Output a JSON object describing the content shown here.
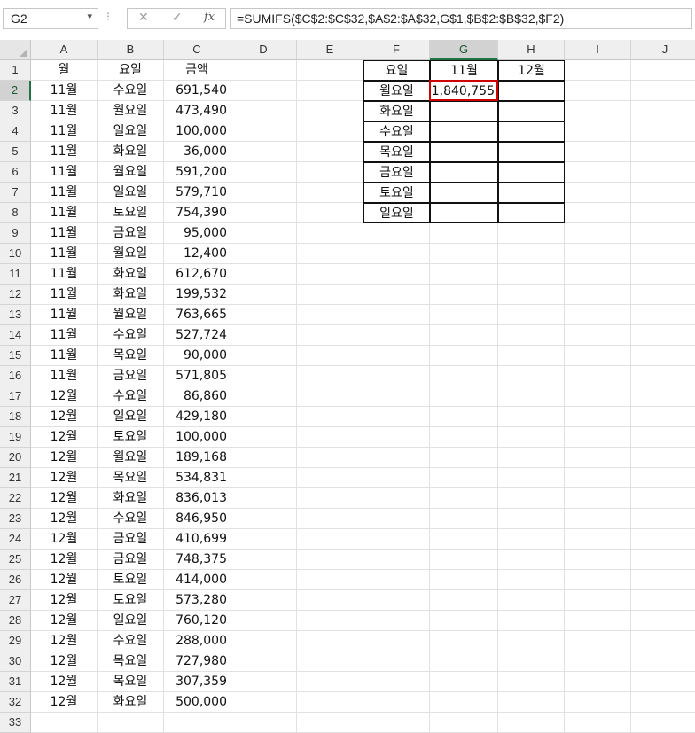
{
  "formula_bar": {
    "name_box": "G2",
    "cancel_icon": "✕",
    "enter_icon": "✓",
    "fx_label": "fx",
    "formula": "=SUMIFS($C$2:$C$32,$A$2:$A$32,G$1,$B$2:$B$32,$F2)"
  },
  "sheet": {
    "columns": [
      "A",
      "B",
      "C",
      "D",
      "E",
      "F",
      "G",
      "H",
      "I",
      "J"
    ],
    "selected_column": "G",
    "selected_row": 2,
    "header_row": {
      "month": "월",
      "day": "요일",
      "amount": "금액"
    },
    "rows": [
      {
        "month": "11월",
        "day": "수요일",
        "amount": "691,540"
      },
      {
        "month": "11월",
        "day": "월요일",
        "amount": "473,490"
      },
      {
        "month": "11월",
        "day": "일요일",
        "amount": "100,000"
      },
      {
        "month": "11월",
        "day": "화요일",
        "amount": "36,000"
      },
      {
        "month": "11월",
        "day": "월요일",
        "amount": "591,200"
      },
      {
        "month": "11월",
        "day": "일요일",
        "amount": "579,710"
      },
      {
        "month": "11월",
        "day": "토요일",
        "amount": "754,390"
      },
      {
        "month": "11월",
        "day": "금요일",
        "amount": "95,000"
      },
      {
        "month": "11월",
        "day": "월요일",
        "amount": "12,400"
      },
      {
        "month": "11월",
        "day": "화요일",
        "amount": "612,670"
      },
      {
        "month": "11월",
        "day": "화요일",
        "amount": "199,532"
      },
      {
        "month": "11월",
        "day": "월요일",
        "amount": "763,665"
      },
      {
        "month": "11월",
        "day": "수요일",
        "amount": "527,724"
      },
      {
        "month": "11월",
        "day": "목요일",
        "amount": "90,000"
      },
      {
        "month": "11월",
        "day": "금요일",
        "amount": "571,805"
      },
      {
        "month": "12월",
        "day": "수요일",
        "amount": "86,860"
      },
      {
        "month": "12월",
        "day": "일요일",
        "amount": "429,180"
      },
      {
        "month": "12월",
        "day": "토요일",
        "amount": "100,000"
      },
      {
        "month": "12월",
        "day": "월요일",
        "amount": "189,168"
      },
      {
        "month": "12월",
        "day": "목요일",
        "amount": "534,831"
      },
      {
        "month": "12월",
        "day": "화요일",
        "amount": "836,013"
      },
      {
        "month": "12월",
        "day": "수요일",
        "amount": "846,950"
      },
      {
        "month": "12월",
        "day": "금요일",
        "amount": "410,699"
      },
      {
        "month": "12월",
        "day": "금요일",
        "amount": "748,375"
      },
      {
        "month": "12월",
        "day": "토요일",
        "amount": "414,000"
      },
      {
        "month": "12월",
        "day": "토요일",
        "amount": "573,280"
      },
      {
        "month": "12월",
        "day": "일요일",
        "amount": "760,120"
      },
      {
        "month": "12월",
        "day": "수요일",
        "amount": "288,000"
      },
      {
        "month": "12월",
        "day": "목요일",
        "amount": "727,980"
      },
      {
        "month": "12월",
        "day": "목요일",
        "amount": "307,359"
      },
      {
        "month": "12월",
        "day": "화요일",
        "amount": "500,000"
      }
    ],
    "summary": {
      "header": [
        "요일",
        "11월",
        "12월"
      ],
      "days": [
        "월요일",
        "화요일",
        "수요일",
        "목요일",
        "금요일",
        "토요일",
        "일요일"
      ],
      "values": [
        [
          "1,840,755",
          ""
        ],
        [
          "",
          ""
        ],
        [
          "",
          ""
        ],
        [
          "",
          ""
        ],
        [
          "",
          ""
        ],
        [
          "",
          ""
        ],
        [
          "",
          ""
        ]
      ]
    },
    "visible_rows": 33,
    "selection_color": "#d00000",
    "accent_color": "#217346"
  }
}
